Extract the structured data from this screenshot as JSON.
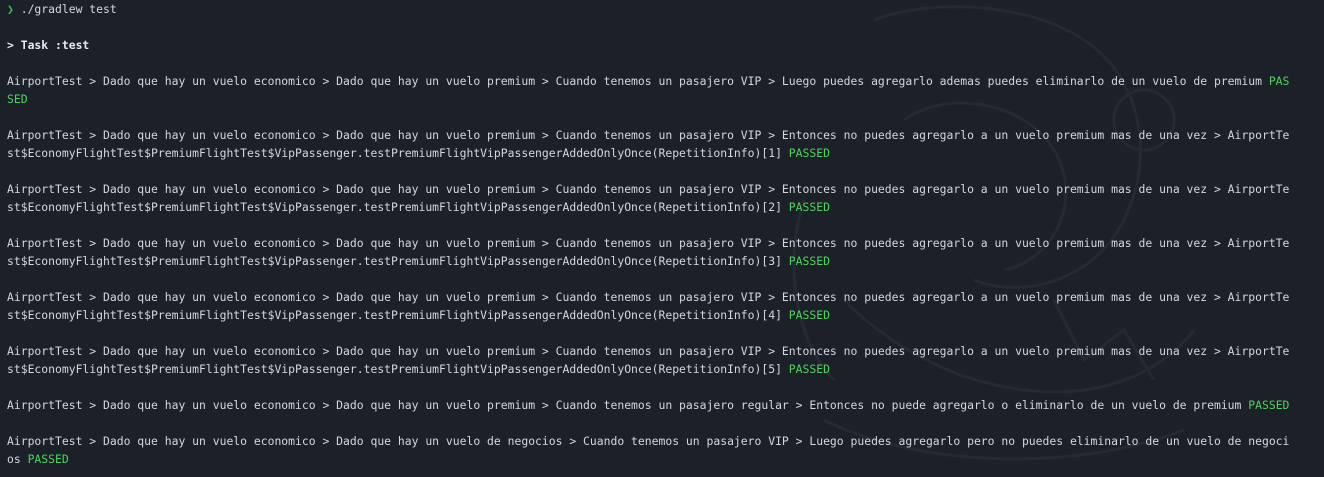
{
  "prompt": {
    "symbol": "❯",
    "command": "./gradlew test"
  },
  "task_header": "> Task :test",
  "status_word_color": "#4ed45c",
  "entries": [
    {
      "line1": "AirportTest > Dado que hay un vuelo economico > Dado que hay un vuelo premium > Cuando tenemos un pasajero VIP > Luego puedes agregarlo ademas puedes eliminarlo de un vuelo de premium ",
      "status1": "PAS",
      "line2": "",
      "status2": "SED"
    },
    {
      "line1": "AirportTest > Dado que hay un vuelo economico > Dado que hay un vuelo premium > Cuando tenemos un pasajero VIP > Entonces no puedes agregarlo a un vuelo premium mas de una vez > AirportTe",
      "status1": "",
      "line2": "st$EconomyFlightTest$PremiumFlightTest$VipPassenger.testPremiumFlightVipPassengerAddedOnlyOnce(RepetitionInfo)[1] ",
      "status2": "PASSED"
    },
    {
      "line1": "AirportTest > Dado que hay un vuelo economico > Dado que hay un vuelo premium > Cuando tenemos un pasajero VIP > Entonces no puedes agregarlo a un vuelo premium mas de una vez > AirportTe",
      "status1": "",
      "line2": "st$EconomyFlightTest$PremiumFlightTest$VipPassenger.testPremiumFlightVipPassengerAddedOnlyOnce(RepetitionInfo)[2] ",
      "status2": "PASSED"
    },
    {
      "line1": "AirportTest > Dado que hay un vuelo economico > Dado que hay un vuelo premium > Cuando tenemos un pasajero VIP > Entonces no puedes agregarlo a un vuelo premium mas de una vez > AirportTe",
      "status1": "",
      "line2": "st$EconomyFlightTest$PremiumFlightTest$VipPassenger.testPremiumFlightVipPassengerAddedOnlyOnce(RepetitionInfo)[3] ",
      "status2": "PASSED"
    },
    {
      "line1": "AirportTest > Dado que hay un vuelo economico > Dado que hay un vuelo premium > Cuando tenemos un pasajero VIP > Entonces no puedes agregarlo a un vuelo premium mas de una vez > AirportTe",
      "status1": "",
      "line2": "st$EconomyFlightTest$PremiumFlightTest$VipPassenger.testPremiumFlightVipPassengerAddedOnlyOnce(RepetitionInfo)[4] ",
      "status2": "PASSED"
    },
    {
      "line1": "AirportTest > Dado que hay un vuelo economico > Dado que hay un vuelo premium > Cuando tenemos un pasajero VIP > Entonces no puedes agregarlo a un vuelo premium mas de una vez > AirportTe",
      "status1": "",
      "line2": "st$EconomyFlightTest$PremiumFlightTest$VipPassenger.testPremiumFlightVipPassengerAddedOnlyOnce(RepetitionInfo)[5] ",
      "status2": "PASSED"
    },
    {
      "line1": "AirportTest > Dado que hay un vuelo economico > Dado que hay un vuelo premium > Cuando tenemos un pasajero regular > Entonces no puede agregarlo o eliminarlo de un vuelo de premium ",
      "status1": "PASSED",
      "line2": null,
      "status2": ""
    },
    {
      "line1": "AirportTest > Dado que hay un vuelo economico > Dado que hay un vuelo de negocios > Cuando tenemos un pasajero VIP > Luego puedes agregarlo pero no puedes eliminarlo de un vuelo de negoci",
      "status1": "",
      "line2": "os ",
      "status2": "PASSED"
    }
  ]
}
